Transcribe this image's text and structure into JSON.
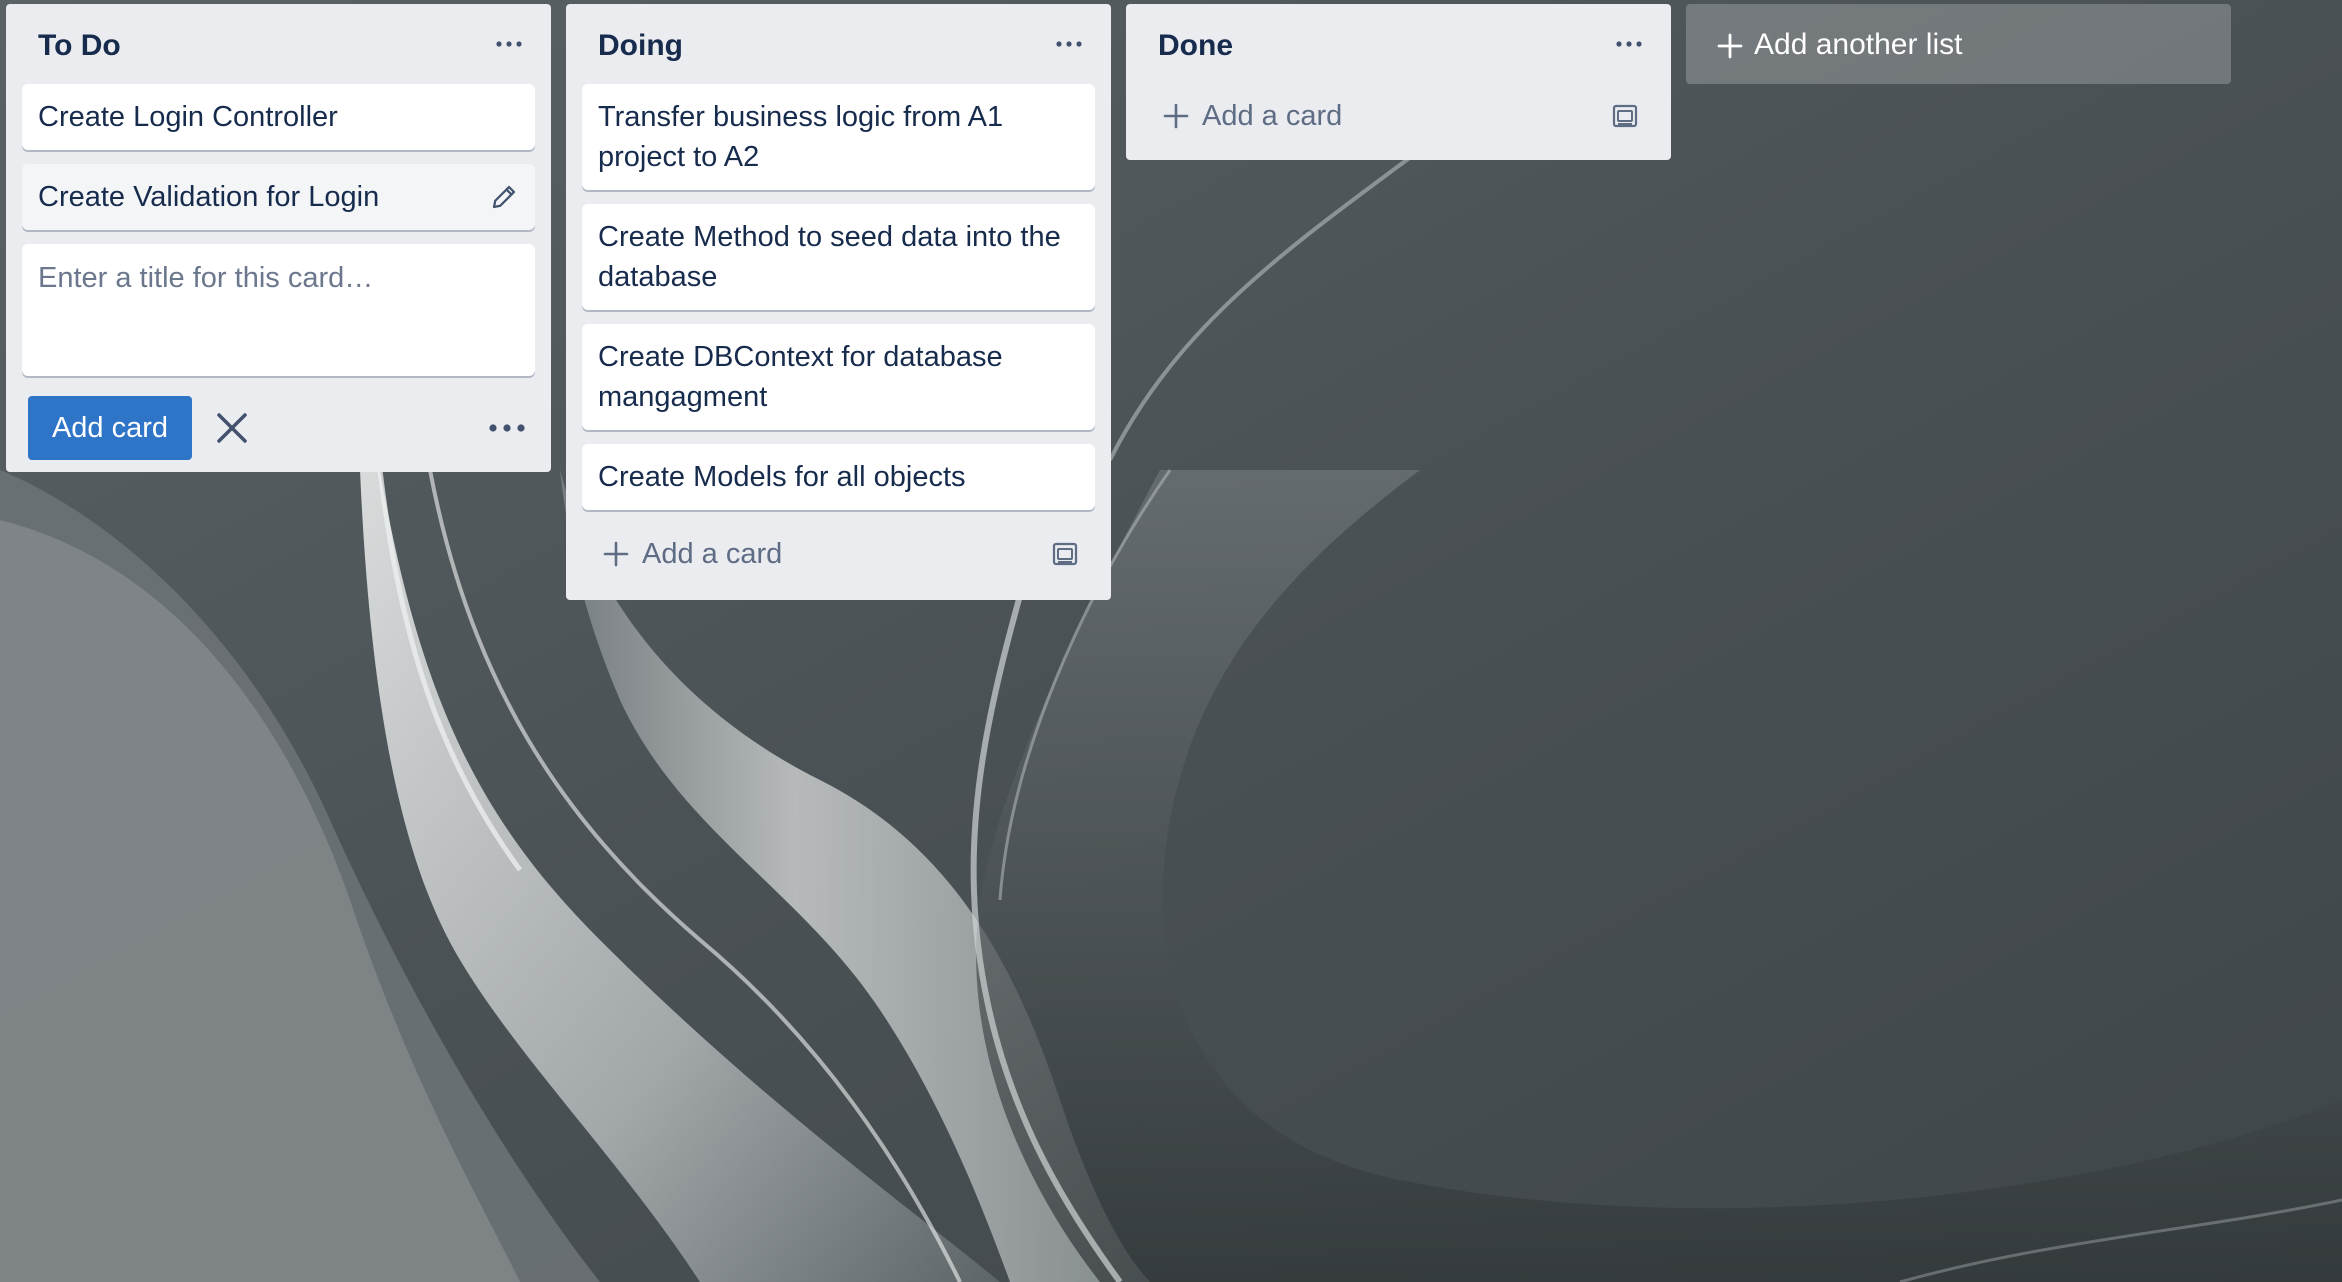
{
  "lists": [
    {
      "title": "To Do",
      "cards": [
        "Create Login Controller",
        "Create Validation for Login"
      ],
      "composer": {
        "placeholder": "Enter a title for this card…",
        "value": "",
        "add_button_label": "Add card"
      }
    },
    {
      "title": "Doing",
      "cards": [
        "Transfer business logic from A1 project to A2",
        "Create Method to seed data into the database",
        "Create DBContext for database mangagment",
        "Create Models for all objects"
      ],
      "add_card_label": "Add a card"
    },
    {
      "title": "Done",
      "cards": [],
      "add_card_label": "Add a card"
    }
  ],
  "add_list_label": "Add another list",
  "colors": {
    "list_bg": "#ebecf0",
    "card_bg": "#ffffff",
    "primary_button": "#2e75c8",
    "text": "#172b4d",
    "muted_text": "#5e6c84"
  },
  "icons": [
    "more-horizontal-icon",
    "pencil-icon",
    "close-icon",
    "plus-icon",
    "card-template-icon"
  ]
}
